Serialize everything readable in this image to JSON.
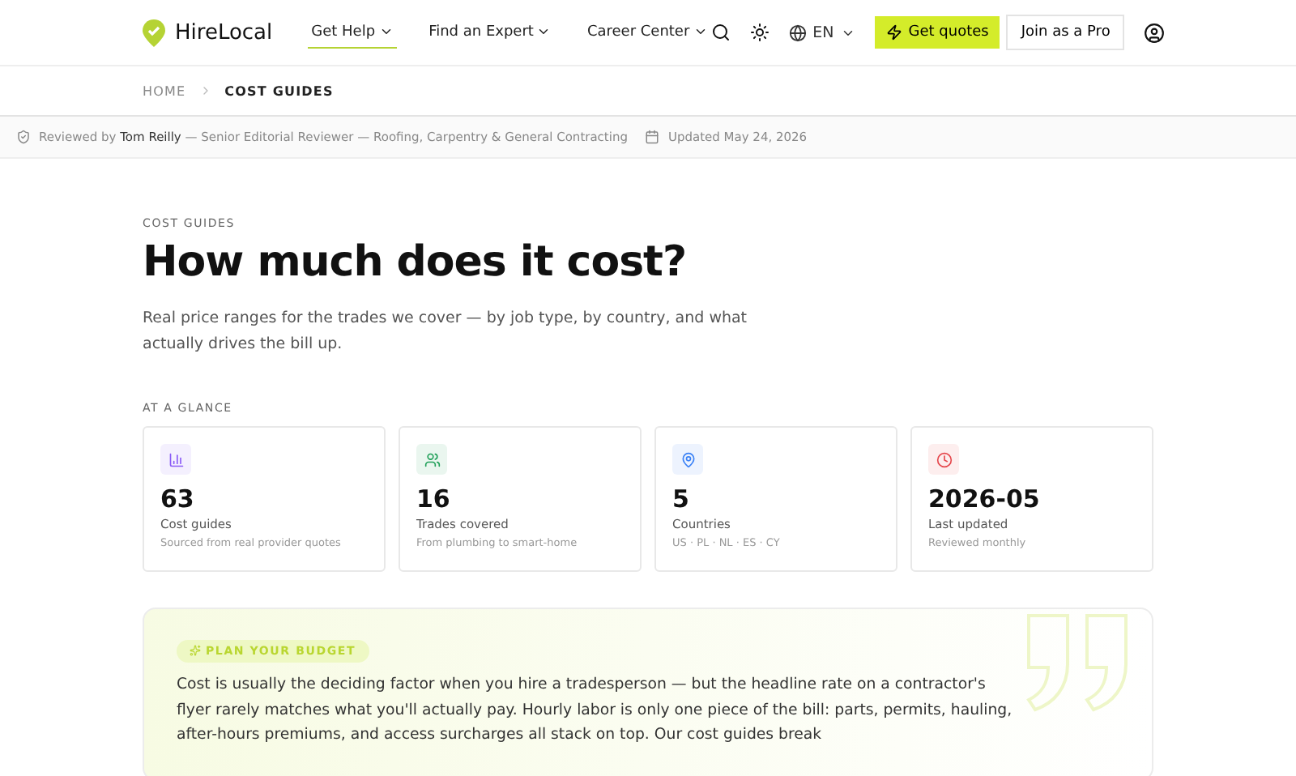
{
  "header": {
    "logo": "HireLocal",
    "nav": [
      {
        "label": "Get Help",
        "selected": true
      },
      {
        "label": "Find an Expert",
        "selected": false
      },
      {
        "label": "Career Center",
        "selected": false
      }
    ],
    "language": "EN",
    "primary_button": "Get quotes",
    "secondary_button": "Join as a Pro"
  },
  "breadcrumbs": [
    {
      "label": "HOME",
      "current": false
    },
    {
      "label": "COST GUIDES",
      "current": true
    }
  ],
  "review_bar": {
    "prefix": "Reviewed by",
    "reviewer": "Tom Reilly",
    "role": "— Senior Editorial Reviewer — Roofing, Carpentry & General Contracting",
    "updated": "Updated May 24, 2026"
  },
  "hero": {
    "eyebrow": "COST GUIDES",
    "title": "How much does it cost?",
    "lead": "Real price ranges for the trades we cover — by job type, by country, and what actually drives the bill up."
  },
  "glance": {
    "heading": "AT A GLANCE",
    "stats": [
      {
        "kind": "chart",
        "color": "#8b5cf6",
        "value": "63",
        "label": "Cost guides",
        "note": "Sourced from real provider quotes"
      },
      {
        "kind": "people",
        "color": "#22a05a",
        "value": "16",
        "label": "Trades covered",
        "note": "From plumbing to smart-home"
      },
      {
        "kind": "pin",
        "color": "#3b82f6",
        "value": "5",
        "label": "Countries",
        "note": "US · PL · NL · ES · CY"
      },
      {
        "kind": "clock",
        "color": "#e5484d",
        "value": "2026-05",
        "label": "Last updated",
        "note": "Reviewed monthly"
      }
    ]
  },
  "budget": {
    "badge": "PLAN YOUR BUDGET",
    "text": "Cost is usually the deciding factor when you hire a tradesperson — but the headline rate on a contractor's flyer rarely matches what you'll actually pay. Hourly labor is only one piece of the bill: parts, permits, hauling, after-hours premiums, and access surcharges all stack on top. Our cost guides break"
  }
}
